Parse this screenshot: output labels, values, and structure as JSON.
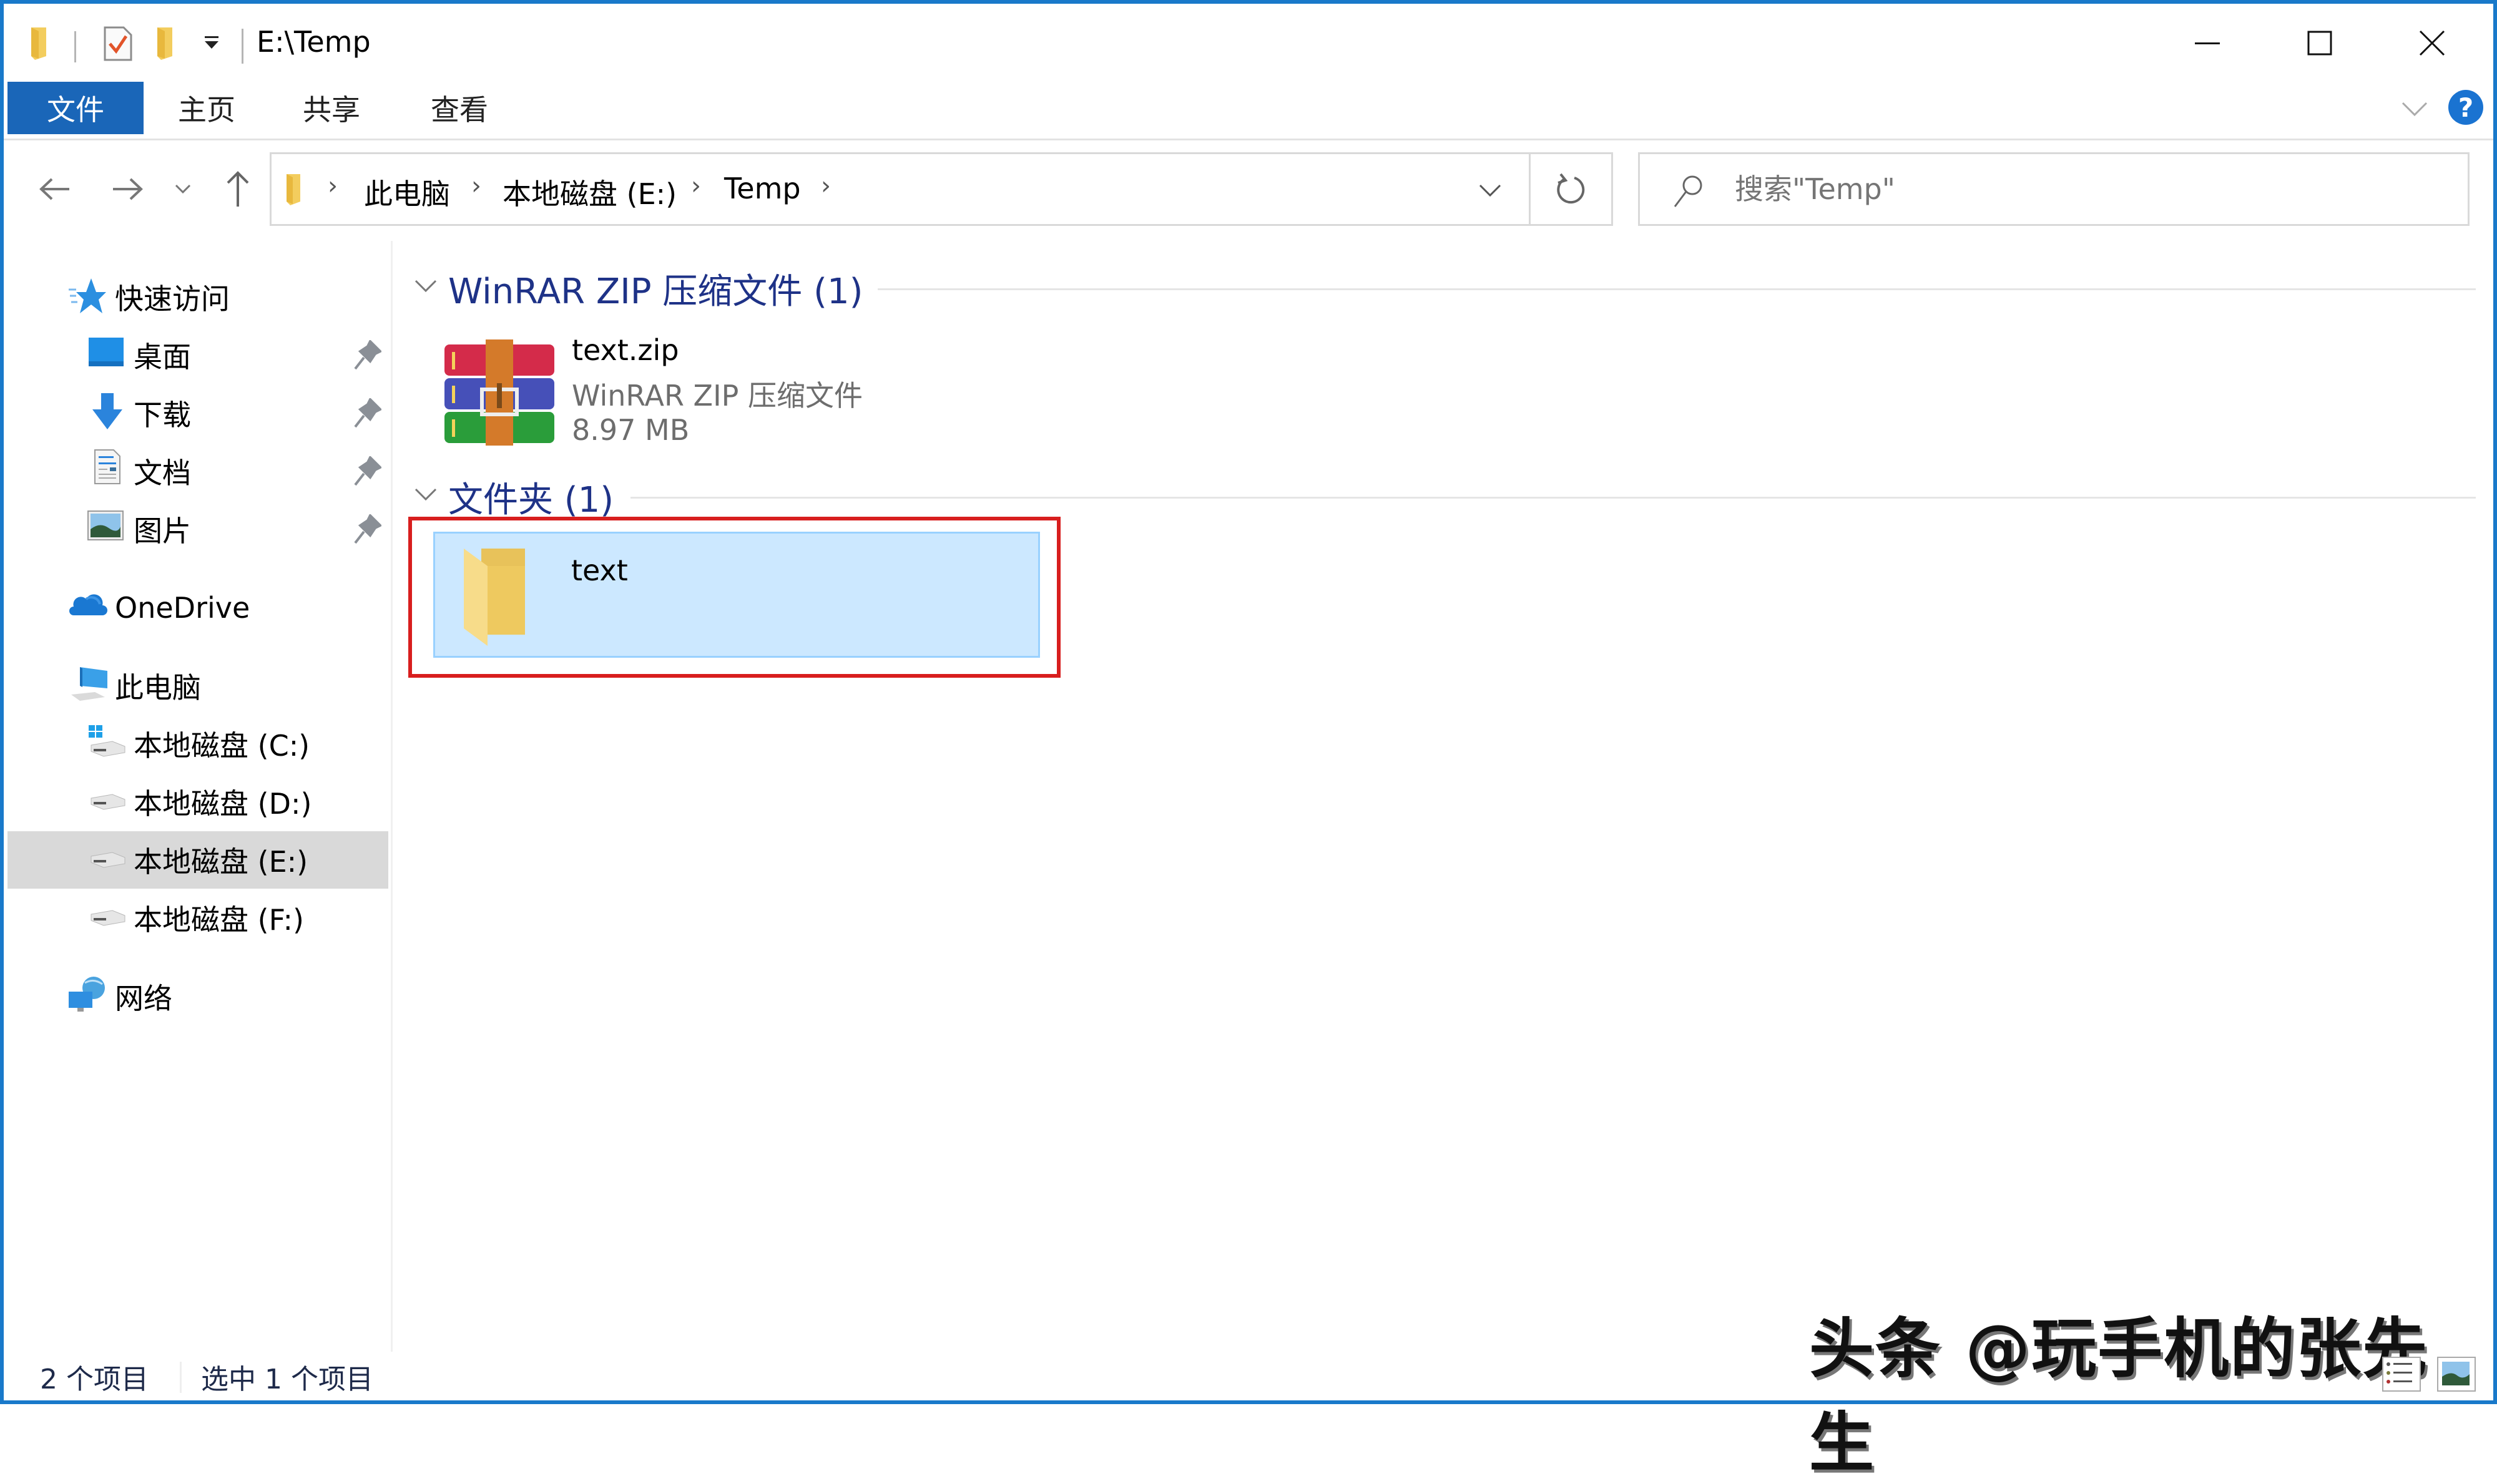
{
  "window": {
    "title": "E:\\Temp",
    "accent_color": "#1979ca",
    "controls": {
      "minimize": "minimize",
      "maximize": "maximize",
      "close": "close"
    }
  },
  "quick_access_toolbar": {
    "icons": [
      "folder-icon",
      "properties-icon",
      "new-folder-icon",
      "customize-dropdown-icon"
    ]
  },
  "ribbon": {
    "tabs": [
      {
        "label": "文件",
        "active": true
      },
      {
        "label": "主页"
      },
      {
        "label": "共享"
      },
      {
        "label": "查看"
      }
    ],
    "expand_icon": "chevron-down-icon",
    "help_label": "?"
  },
  "navigation": {
    "back": "back-arrow",
    "forward": "forward-arrow",
    "recent": "recent-dropdown",
    "up": "up-arrow"
  },
  "address_bar": {
    "crumbs": [
      "此电脑",
      "本地磁盘 (E:)",
      "Temp"
    ]
  },
  "search": {
    "placeholder": "搜索\"Temp\""
  },
  "sidebar": {
    "quick_access": {
      "label": "快速访问",
      "items": [
        {
          "label": "桌面",
          "icon": "desktop-icon",
          "pinned": true
        },
        {
          "label": "下载",
          "icon": "download-icon",
          "pinned": true
        },
        {
          "label": "文档",
          "icon": "documents-icon",
          "pinned": true
        },
        {
          "label": "图片",
          "icon": "pictures-icon",
          "pinned": true
        }
      ]
    },
    "onedrive": {
      "label": "OneDrive"
    },
    "this_pc": {
      "label": "此电脑",
      "drives": [
        {
          "label": "本地磁盘 (C:)",
          "selected": false
        },
        {
          "label": "本地磁盘 (D:)",
          "selected": false
        },
        {
          "label": "本地磁盘 (E:)",
          "selected": true
        },
        {
          "label": "本地磁盘 (F:)",
          "selected": false
        }
      ]
    },
    "network": {
      "label": "网络"
    }
  },
  "content": {
    "groups": [
      {
        "header": "WinRAR ZIP 压缩文件 (1)",
        "items": [
          {
            "name": "text.zip",
            "type": "WinRAR ZIP 压缩文件",
            "size": "8.97 MB"
          }
        ]
      },
      {
        "header": "文件夹 (1)",
        "items": [
          {
            "name": "text",
            "selected": true
          }
        ]
      }
    ],
    "highlight_color": "#d81e1e"
  },
  "status_bar": {
    "item_count": "2 个项目",
    "selection": "选中 1 个项目"
  },
  "watermark": "头条 @玩手机的张先生"
}
